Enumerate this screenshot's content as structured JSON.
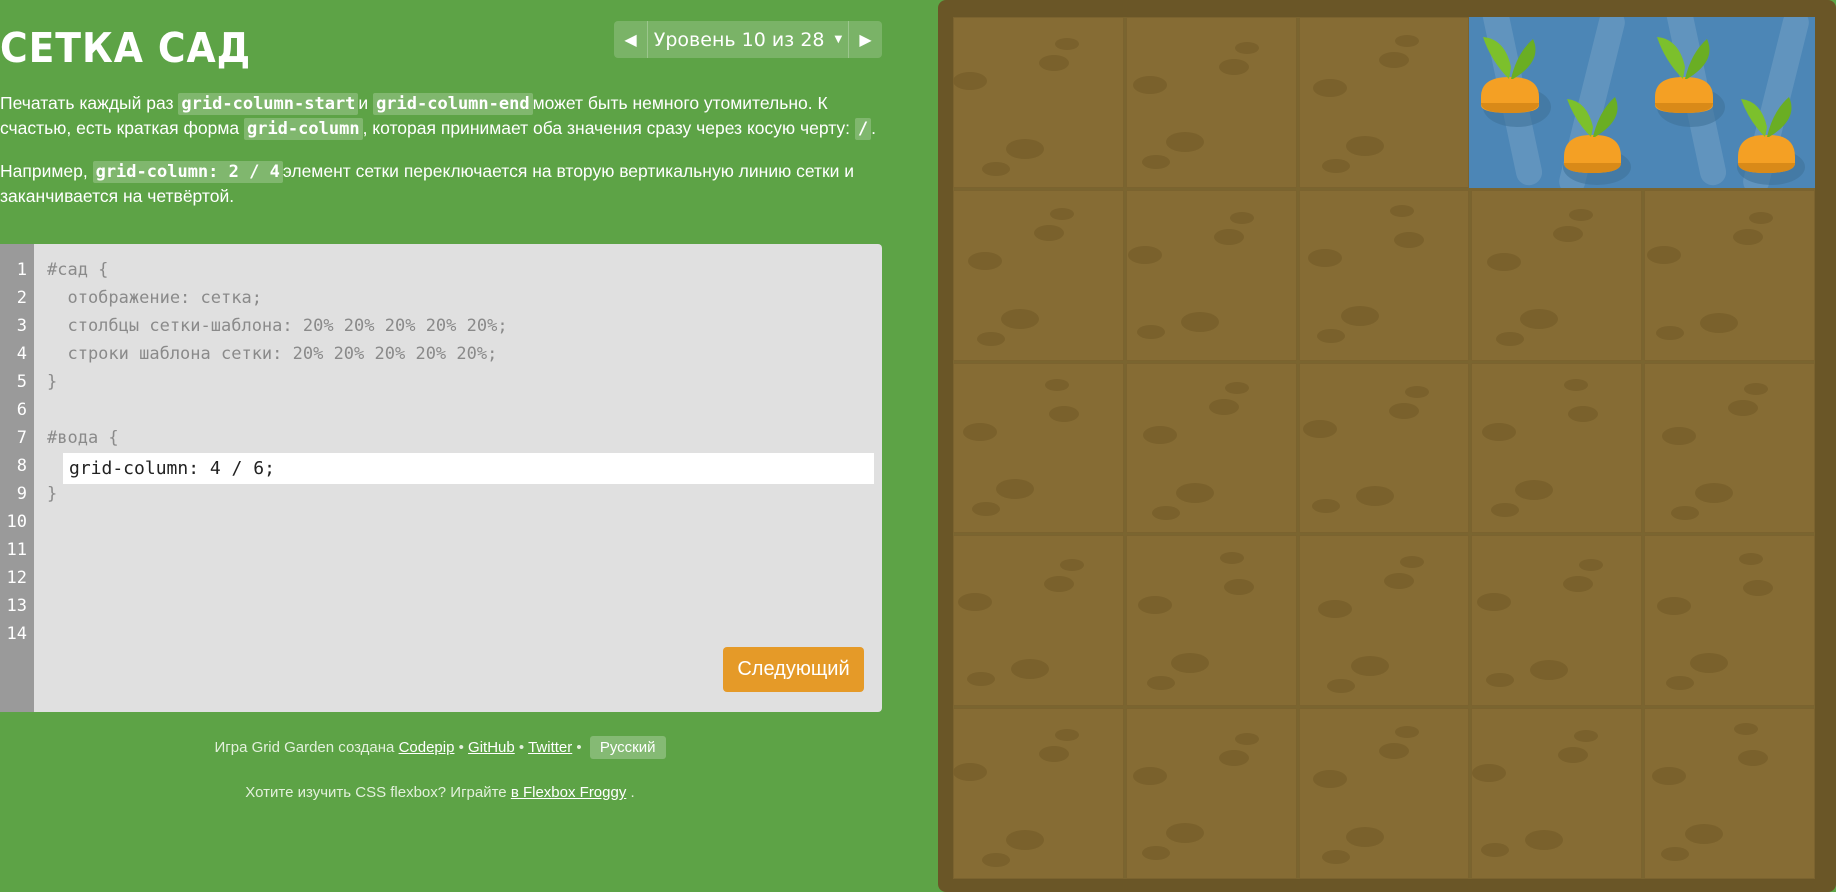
{
  "title": "СЕТКА САД",
  "level": {
    "label": "Уровень 10 из 28"
  },
  "instructions": {
    "p1": {
      "t1": "Печатать каждый раз ",
      "c1": "grid-column-start",
      "t2": "и ",
      "c2": "grid-column-end",
      "t3": "может быть немного утомительно. К счастью, есть краткая форма ",
      "c3": "grid-column",
      "t4": ", которая принимает оба значения сразу через косую черту: ",
      "c4": "/",
      "t5": "."
    },
    "p2": {
      "t1": "Например, ",
      "c1": "grid-column: 2 / 4",
      "t2": "элемент сетки переключается на вторую вертикальную линию сетки и заканчивается на четвёртой."
    }
  },
  "editor": {
    "line_numbers": [
      "1",
      "2",
      "3",
      "4",
      "5",
      "6",
      "7",
      "8",
      "9",
      "10",
      "11",
      "12",
      "13",
      "14"
    ],
    "lines": {
      "l1": "#сад {",
      "l2": "  отображение: сетка;",
      "l3": "  столбцы сетки-шаблона: 20% 20% 20% 20% 20%;",
      "l4": "  строки шаблона сетки: 20% 20% 20% 20% 20%;",
      "l5": "}",
      "l7": "#вода {",
      "l9": "}"
    },
    "input_value": "grid-column: 4 / 6;",
    "next_label": "Следующий"
  },
  "footer": {
    "credit_prefix": "Игра Grid Garden создана ",
    "codepip": "Codepip",
    "github": "GitHub",
    "twitter": "Twitter",
    "sep": " • ",
    "language": "Русский",
    "flexbox_prefix": "Хотите изучить CSS flexbox? Играйте ",
    "flexbox_link": "в Flexbox Froggy",
    "flexbox_suffix": " ."
  },
  "garden": {
    "columns": 5,
    "rows": 5,
    "water_columns": [
      4,
      5
    ],
    "water_rows": [
      1
    ],
    "carrots": 4
  },
  "colors": {
    "background": "#5da346",
    "soil": "#866c34",
    "water": "#4c86b6",
    "carrot": "#f4a024",
    "leaf": "#7cc02c",
    "next_button": "#e59a28"
  }
}
